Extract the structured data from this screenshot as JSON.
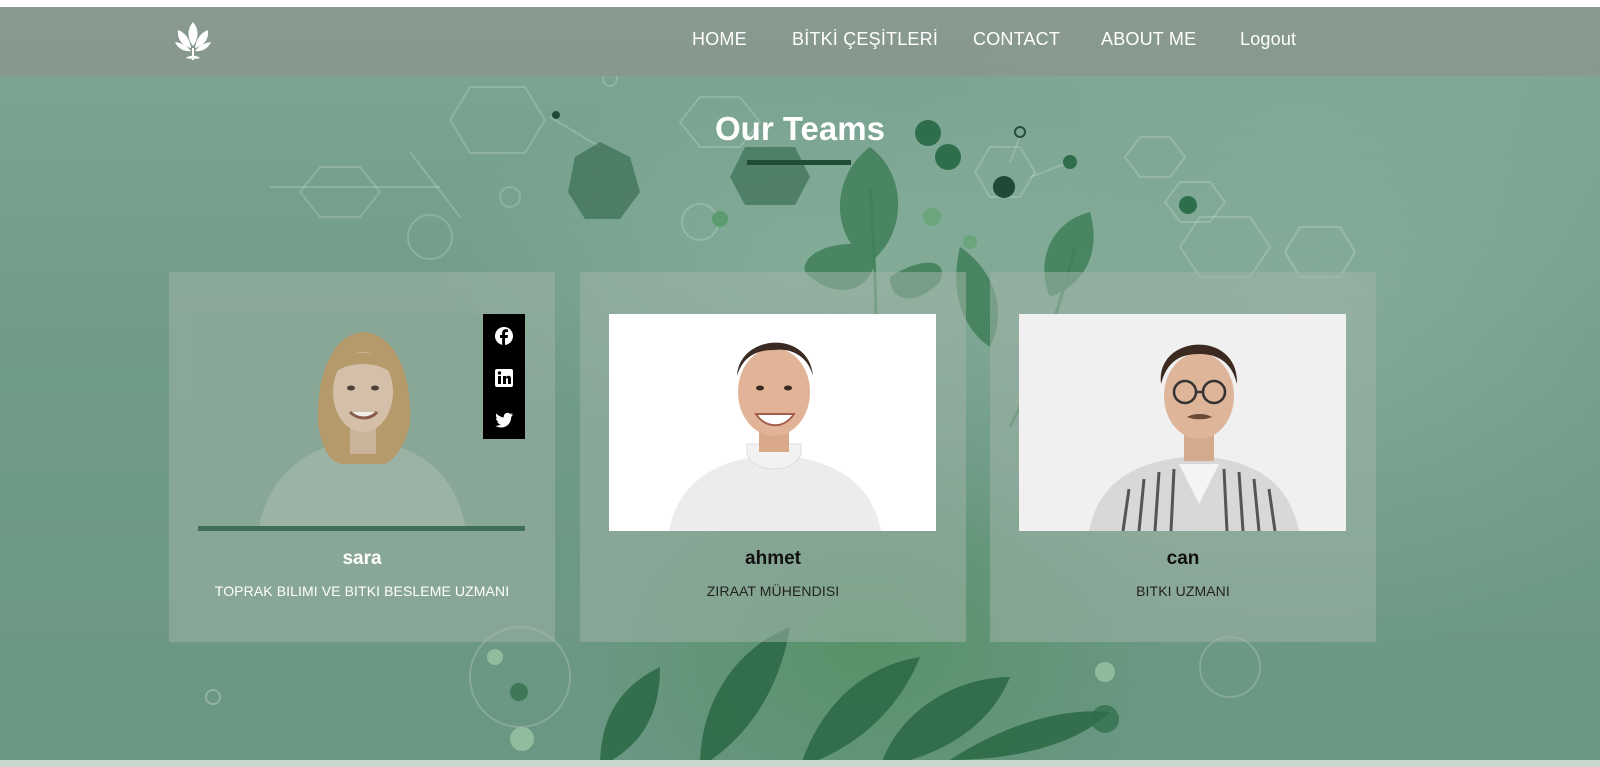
{
  "nav": {
    "logo_icon": "leaf-logo-icon",
    "links": [
      {
        "label": "HOME"
      },
      {
        "label": "BİTKİ ÇEŞİTLERİ"
      },
      {
        "label": "CONTACT"
      },
      {
        "label": "ABOUT ME"
      },
      {
        "label": "Logout"
      }
    ]
  },
  "section": {
    "title": "Our Teams",
    "accent_color": "#1f4d36"
  },
  "team": [
    {
      "name": "sara",
      "role": "TOPRAK BILIMI VE BITKI BESLEME UZMANI",
      "name_color": "#ffffff",
      "role_color": "#ffffff",
      "social": [
        "facebook-icon",
        "linkedin-icon",
        "twitter-icon"
      ]
    },
    {
      "name": "ahmet",
      "role": "ZIRAAT MÜHENDISI",
      "name_color": "#111111",
      "role_color": "#222222"
    },
    {
      "name": "can",
      "role": "BITKI UZMANI",
      "name_color": "#111111",
      "role_color": "#222222"
    }
  ]
}
